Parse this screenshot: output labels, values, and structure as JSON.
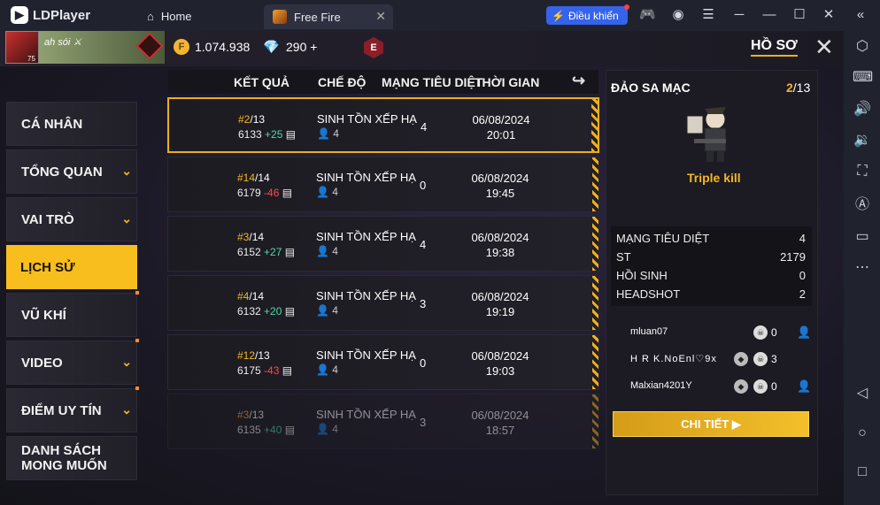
{
  "ldplayer": {
    "brand": "LDPlayer",
    "home_tab": "Home",
    "active_tab": "Free Fire",
    "control_button": "Điều khiển"
  },
  "header": {
    "nickname": "ah sói ⚔",
    "level": "75",
    "gold": "1.074.938",
    "diamonds": "290",
    "plus": "+",
    "rank_letter": "E",
    "title": "HỒ SƠ"
  },
  "menu": [
    {
      "label": "CÁ NHÂN",
      "chevron": false
    },
    {
      "label": "TỔNG QUAN",
      "chevron": true
    },
    {
      "label": "VAI TRÒ",
      "chevron": true
    },
    {
      "label": "LỊCH SỬ",
      "chevron": false,
      "active": true
    },
    {
      "label": "VŨ KHÍ",
      "chevron": false
    },
    {
      "label": "VIDEO",
      "chevron": true
    },
    {
      "label": "ĐIỂM UY TÍN",
      "chevron": true
    },
    {
      "label": "DANH SÁCH MONG MUỐN",
      "chevron": false
    }
  ],
  "table": {
    "headers": [
      "KẾT QUẢ",
      "CHẾ ĐỘ",
      "MẠNG TIÊU DIỆT",
      "THỜI GIAN"
    ],
    "rows": [
      {
        "rank": "#2",
        "total": "/13",
        "points": "6133",
        "delta": "+25",
        "mode": "SINH TỒN XẾP HẠ",
        "players": "4",
        "kills": "4",
        "date": "06/08/2024",
        "time": "20:01"
      },
      {
        "rank": "#14",
        "total": "/14",
        "points": "6179",
        "delta": "-46",
        "mode": "SINH TỒN XẾP HẠ",
        "players": "4",
        "kills": "0",
        "date": "06/08/2024",
        "time": "19:45"
      },
      {
        "rank": "#3",
        "total": "/14",
        "points": "6152",
        "delta": "+27",
        "mode": "SINH TỒN XẾP HẠ",
        "players": "4",
        "kills": "4",
        "date": "06/08/2024",
        "time": "19:38"
      },
      {
        "rank": "#4",
        "total": "/14",
        "points": "6132",
        "delta": "+20",
        "mode": "SINH TỒN XẾP HẠ",
        "players": "4",
        "kills": "3",
        "date": "06/08/2024",
        "time": "19:19"
      },
      {
        "rank": "#12",
        "total": "/13",
        "points": "6175",
        "delta": "-43",
        "mode": "SINH TỒN XẾP HẠ",
        "players": "4",
        "kills": "0",
        "date": "06/08/2024",
        "time": "19:03"
      },
      {
        "rank": "#3",
        "total": "/13",
        "points": "6135",
        "delta": "+40",
        "mode": "SINH TỒN XẾP HẠ",
        "players": "4",
        "kills": "3",
        "date": "06/08/2024",
        "time": "18:57"
      }
    ]
  },
  "detail": {
    "map": "ĐẢO SA MẠC",
    "rank": "2",
    "total": "/13",
    "highlight": "Triple kill",
    "stats": [
      {
        "label": "MẠNG TIÊU DIỆT",
        "value": "4"
      },
      {
        "label": "ST",
        "value": "2179"
      },
      {
        "label": "HỒI SINH",
        "value": "0"
      },
      {
        "label": "HEADSHOT",
        "value": "2"
      }
    ],
    "team": [
      {
        "name": "mluan07",
        "kills": "0"
      },
      {
        "name": "H R K.NoEnl♡9x",
        "kills": "3"
      },
      {
        "name": "Malxian4201Y",
        "kills": "0"
      }
    ],
    "button": "CHI TIẾT"
  },
  "colors": {
    "accent": "#f7be1d",
    "up": "#4fd9a8",
    "down": "#ff4a4a",
    "emulator_bar": "#20232e"
  }
}
